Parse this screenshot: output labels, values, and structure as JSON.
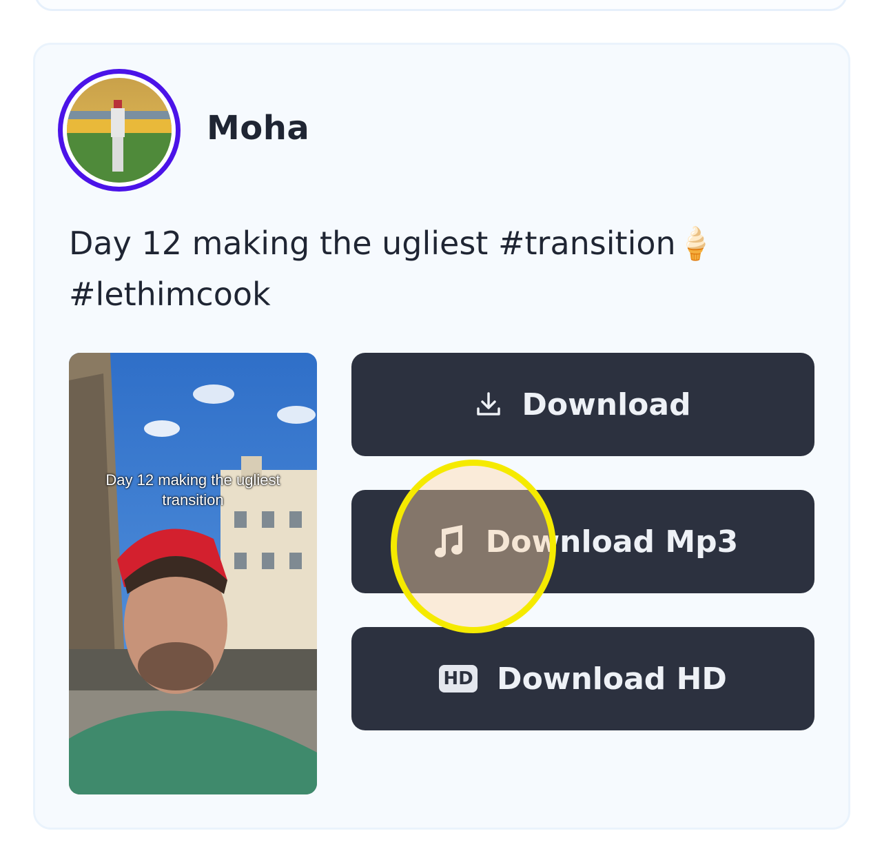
{
  "post": {
    "author": "Moha",
    "caption_line1": "Day 12 making the ugliest #transition🍦",
    "caption_line2": "#lethimcook",
    "thumbnail_overlay_line1": "Day 12 making the ugliest",
    "thumbnail_overlay_line2": "transition"
  },
  "actions": {
    "download": {
      "label": "Download",
      "icon": "download-icon"
    },
    "download_mp3": {
      "label": "Download Mp3",
      "icon": "music-note-icon"
    },
    "download_hd": {
      "label": "Download HD",
      "icon": "hd-badge-icon",
      "badge": "HD"
    }
  },
  "colors": {
    "button_bg": "#2c313f",
    "avatar_ring": "#4b13e8",
    "touch_indicator": "#f5ea00"
  }
}
